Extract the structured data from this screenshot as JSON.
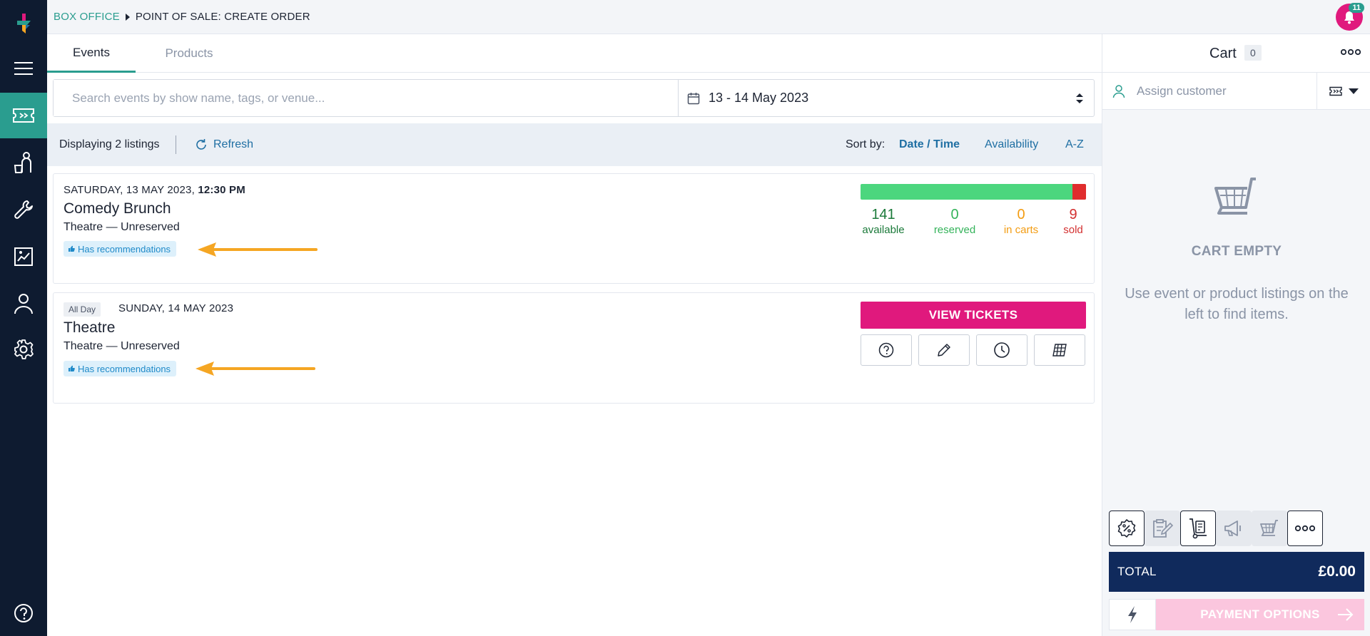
{
  "breadcrumb": {
    "section": "BOX OFFICE",
    "page": "POINT OF SALE: CREATE ORDER"
  },
  "notifications": {
    "count": "11"
  },
  "tabs": [
    {
      "label": "Events"
    },
    {
      "label": "Products"
    }
  ],
  "search": {
    "placeholder": "Search events by show name, tags, or venue...",
    "value": ""
  },
  "date_range": {
    "value": "13 - 14 May 2023"
  },
  "listing": {
    "count_text": "Displaying 2 listings",
    "refresh_label": "Refresh",
    "sort_label": "Sort by:",
    "sort_options": [
      {
        "label": "Date / Time",
        "active": true
      },
      {
        "label": "Availability",
        "active": false
      },
      {
        "label": "A-Z",
        "active": false
      }
    ]
  },
  "events": [
    {
      "date": "SATURDAY, 13 MAY 2023,",
      "time": "12:30 PM",
      "title": "Comedy Brunch",
      "venue": "Theatre — Unreserved",
      "badge": "Has recommendations",
      "stats": {
        "available": {
          "value": "141",
          "label": "available"
        },
        "reserved": {
          "value": "0",
          "label": "reserved"
        },
        "in_carts": {
          "value": "0",
          "label": "in carts"
        },
        "sold": {
          "value": "9",
          "label": "sold"
        }
      },
      "sold_fraction": 0.06
    },
    {
      "all_day_label": "All Day",
      "date": "SUNDAY, 14 MAY 2023",
      "title": "Theatre",
      "venue": "Theatre — Unreserved",
      "badge": "Has recommendations",
      "view_button": "VIEW TICKETS"
    }
  ],
  "cart": {
    "title": "Cart",
    "count": "0",
    "assign_placeholder": "Assign customer",
    "empty_title": "CART EMPTY",
    "empty_message": "Use event or product listings on the left to find items.",
    "total_label": "TOTAL",
    "total_value": "£0.00",
    "payment_label": "PAYMENT OPTIONS"
  },
  "colors": {
    "sidebar": "#0e1b30",
    "accent": "#2a9d8f",
    "pink": "#e0197d",
    "navy": "#102a5c",
    "link": "#1f6fa3",
    "arrow": "#f5a623"
  }
}
